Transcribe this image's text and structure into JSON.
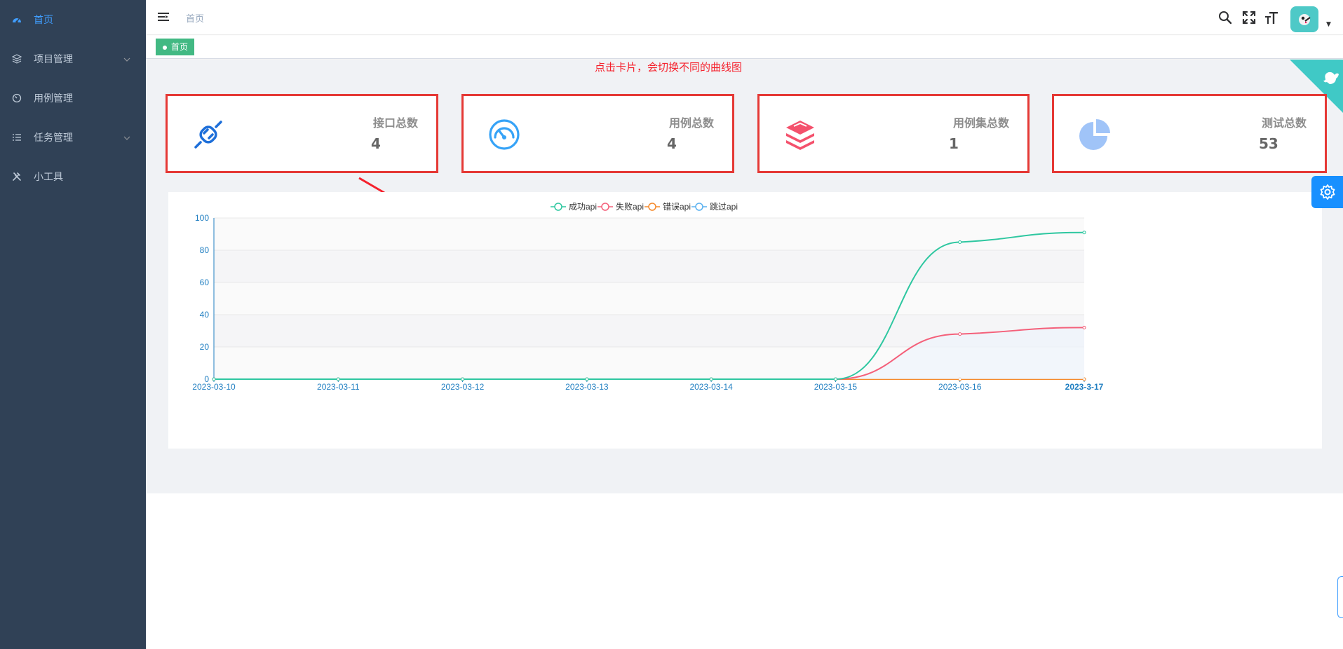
{
  "sidebar": {
    "items": [
      {
        "label": "首页",
        "icon": "dashboard-icon",
        "active": true
      },
      {
        "label": "项目管理",
        "icon": "layers-icon",
        "submenu": true
      },
      {
        "label": "用例管理",
        "icon": "gauge-icon"
      },
      {
        "label": "任务管理",
        "icon": "list-icon",
        "submenu": true
      },
      {
        "label": "小工具",
        "icon": "tools-icon"
      }
    ]
  },
  "navbar": {
    "breadcrumb": "首页",
    "icons": [
      "search-icon",
      "fullscreen-icon",
      "font-size-icon"
    ]
  },
  "tags": {
    "active": "首页",
    "color": "#42b983"
  },
  "hint": "点击卡片，会切换不同的曲线图",
  "cards": [
    {
      "title": "接口总数",
      "value": "4",
      "icon": "plug-icon",
      "color": "#1e6fd9"
    },
    {
      "title": "用例总数",
      "value": "4",
      "icon": "gauge-icon",
      "color": "#36a3f7"
    },
    {
      "title": "用例集总数",
      "value": "1",
      "icon": "stack-icon",
      "color": "#f4516c"
    },
    {
      "title": "测试总数",
      "value": "53",
      "icon": "pie-icon",
      "color": "#a0c4f8"
    }
  ],
  "colors": {
    "sidebar_bg": "#304156",
    "accent": "#409eff",
    "card_border": "#e53935",
    "hint": "#f5222d"
  },
  "chart_data": {
    "type": "line",
    "x": [
      "2023-03-10",
      "2023-03-11",
      "2023-03-12",
      "2023-03-13",
      "2023-03-14",
      "2023-03-15",
      "2023-03-16",
      "2023-3-17"
    ],
    "ylim": [
      0,
      100
    ],
    "yticks": [
      0,
      20,
      40,
      60,
      80,
      100
    ],
    "legend_position": "top-center",
    "smooth": true,
    "series": [
      {
        "name": "成功api",
        "color": "#2ec7a0",
        "values": [
          0,
          0,
          0,
          0,
          0,
          0,
          85,
          91
        ]
      },
      {
        "name": "失败api",
        "color": "#f4607a",
        "values": [
          0,
          0,
          0,
          0,
          0,
          0,
          28,
          32
        ]
      },
      {
        "name": "错误api",
        "color": "#f58a2c",
        "values": [
          0,
          0,
          0,
          0,
          0,
          0,
          0,
          0
        ]
      },
      {
        "name": "跳过api",
        "color": "#5ab1ef",
        "values": [
          0,
          0,
          0,
          0,
          0,
          0,
          0,
          0
        ]
      }
    ]
  }
}
